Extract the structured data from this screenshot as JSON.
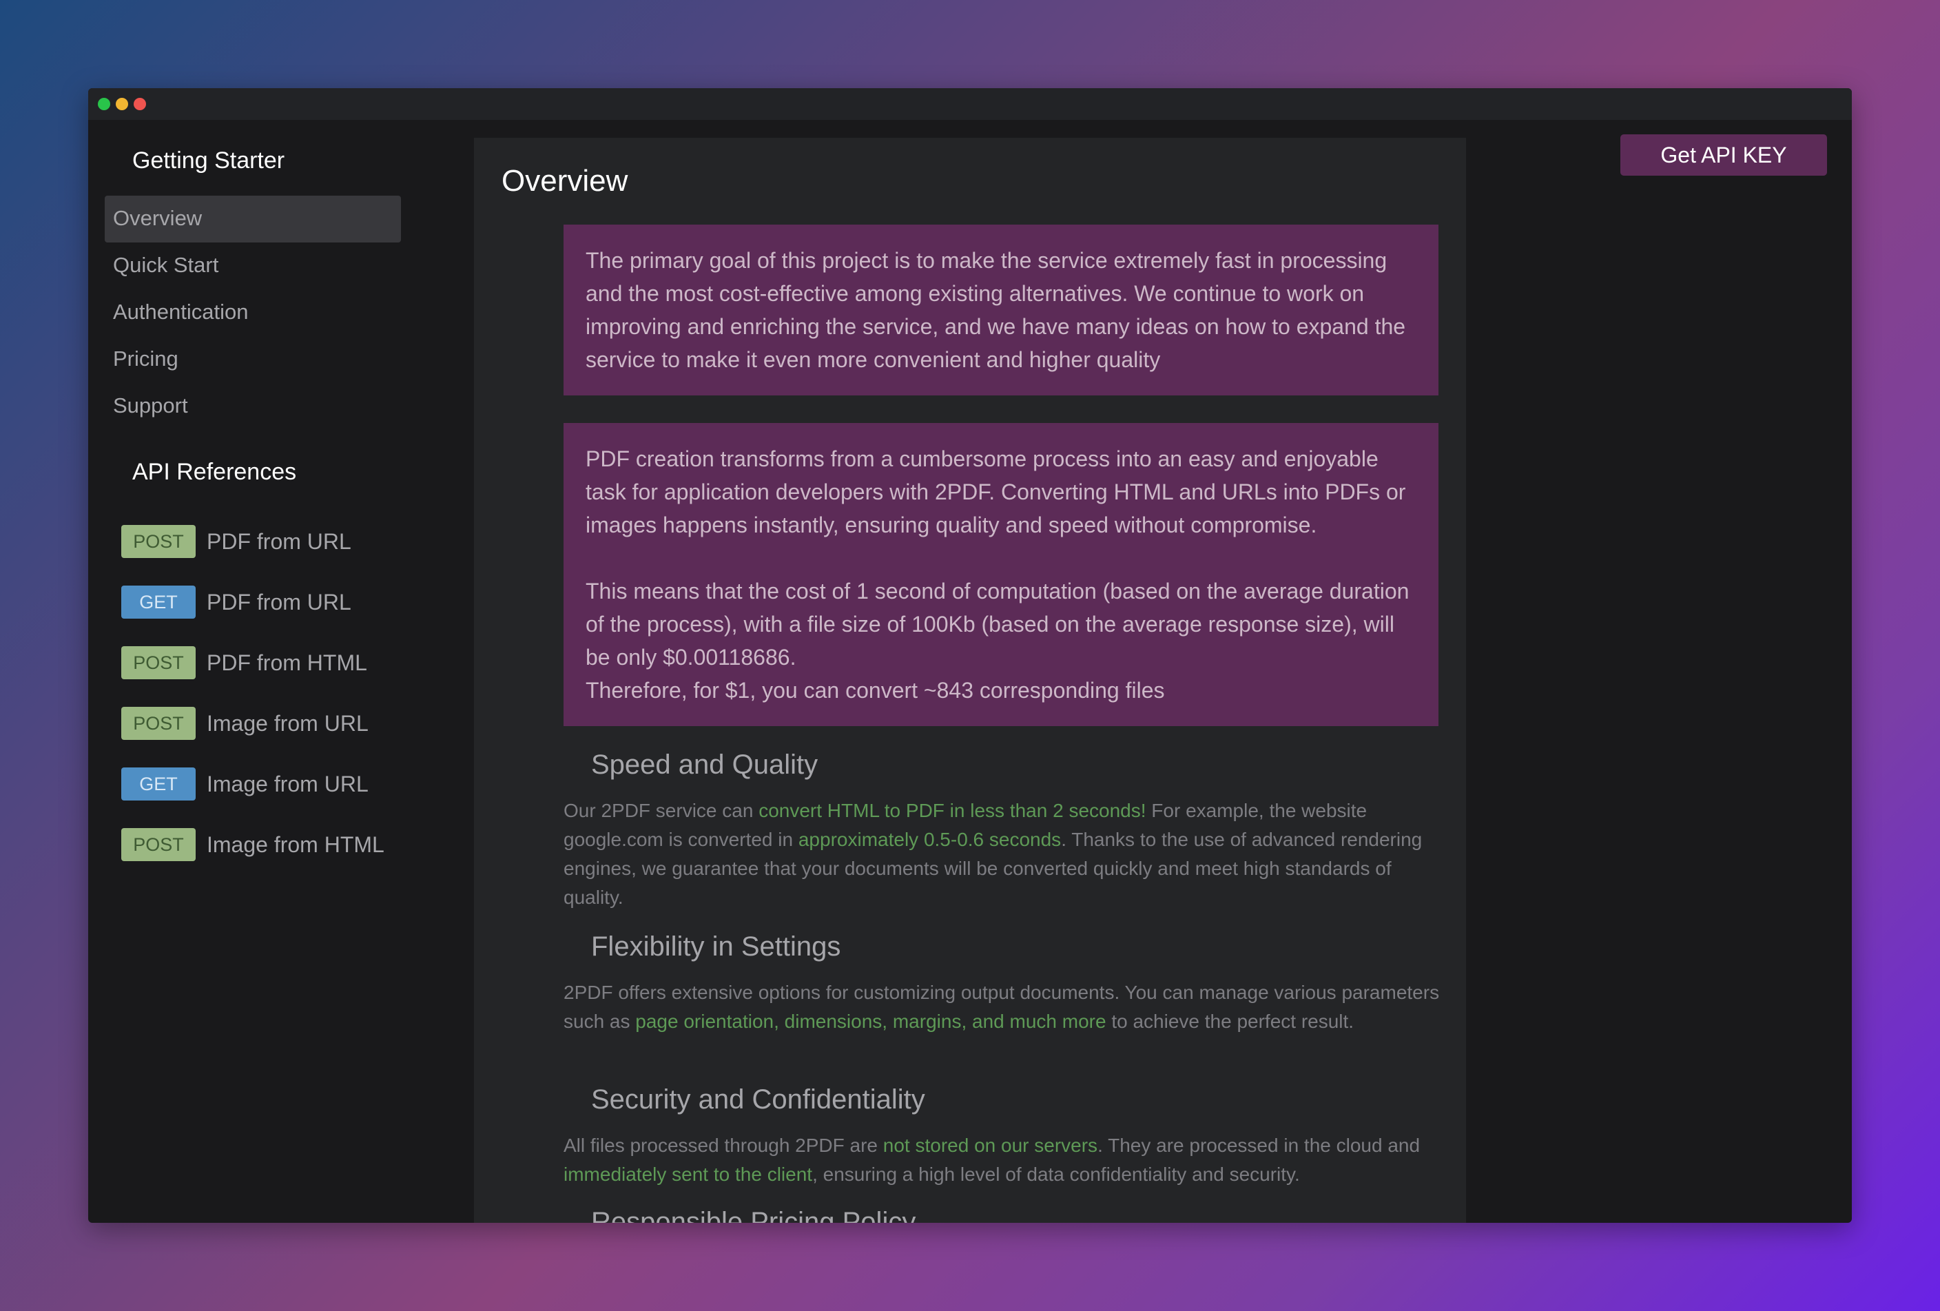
{
  "sidebar": {
    "getting_started_title": "Getting Starter",
    "nav": [
      {
        "label": "Overview",
        "active": true
      },
      {
        "label": "Quick Start"
      },
      {
        "label": "Authentication"
      },
      {
        "label": "Pricing"
      },
      {
        "label": "Support"
      }
    ],
    "api_title": "API References",
    "api": [
      {
        "method": "POST",
        "label": "PDF from URL"
      },
      {
        "method": "GET",
        "label": "PDF from URL"
      },
      {
        "method": "POST",
        "label": "PDF from HTML"
      },
      {
        "method": "POST",
        "label": "Image from URL"
      },
      {
        "method": "GET",
        "label": "Image from URL"
      },
      {
        "method": "POST",
        "label": "Image from HTML"
      }
    ]
  },
  "header": {
    "api_key_button": "Get API KEY"
  },
  "main": {
    "title": "Overview",
    "box1": "The primary goal of this project is to make the service extremely fast in processing and the most cost-effective among existing alternatives. We continue to work on improving and enriching the service, and we have many ideas on how to expand the service to make it even more convenient and higher quality",
    "box2_p1": "PDF creation transforms from a cumbersome process into an easy and enjoyable task for application developers with 2PDF. Converting HTML and URLs into PDFs or images happens instantly, ensuring quality and speed without compromise.",
    "box2_p2": "This means that the cost of 1 second of computation (based on the average duration of the process), with a file size of 100Kb (based on the average response size), will be only $0.00118686.",
    "box2_p3": "Therefore, for $1, you can convert ~843 corresponding files",
    "speed": {
      "heading": "Speed and Quality",
      "t1": "Our 2PDF service can ",
      "h1": "convert HTML to PDF in less than 2 seconds!",
      "t2": " For example, the website google.com is converted in ",
      "h2": "approximately 0.5-0.6 seconds",
      "t3": ". Thanks to the use of advanced rendering engines, we guarantee that your documents will be converted quickly and meet high standards of quality."
    },
    "flex": {
      "heading": "Flexibility in Settings",
      "t1": "2PDF offers extensive options for customizing output documents. You can manage various parameters such as ",
      "h1": "page orientation, dimensions, margins, and much more",
      "t2": " to achieve the perfect result."
    },
    "security": {
      "heading": "Security and Confidentiality",
      "t1": "All files processed through 2PDF are ",
      "h1": "not stored on our servers",
      "t2": ". They are processed in the cloud and ",
      "h2": "immediately sent to the client",
      "t3": ", ensuring a high level of data confidentiality and security."
    },
    "pricing_heading": "Responsible Pricing Policy"
  },
  "colors": {
    "accent": "#5c2b57",
    "highlight": "#5e9a56",
    "post_badge": "#9bb882",
    "get_badge": "#4f8fc5"
  }
}
